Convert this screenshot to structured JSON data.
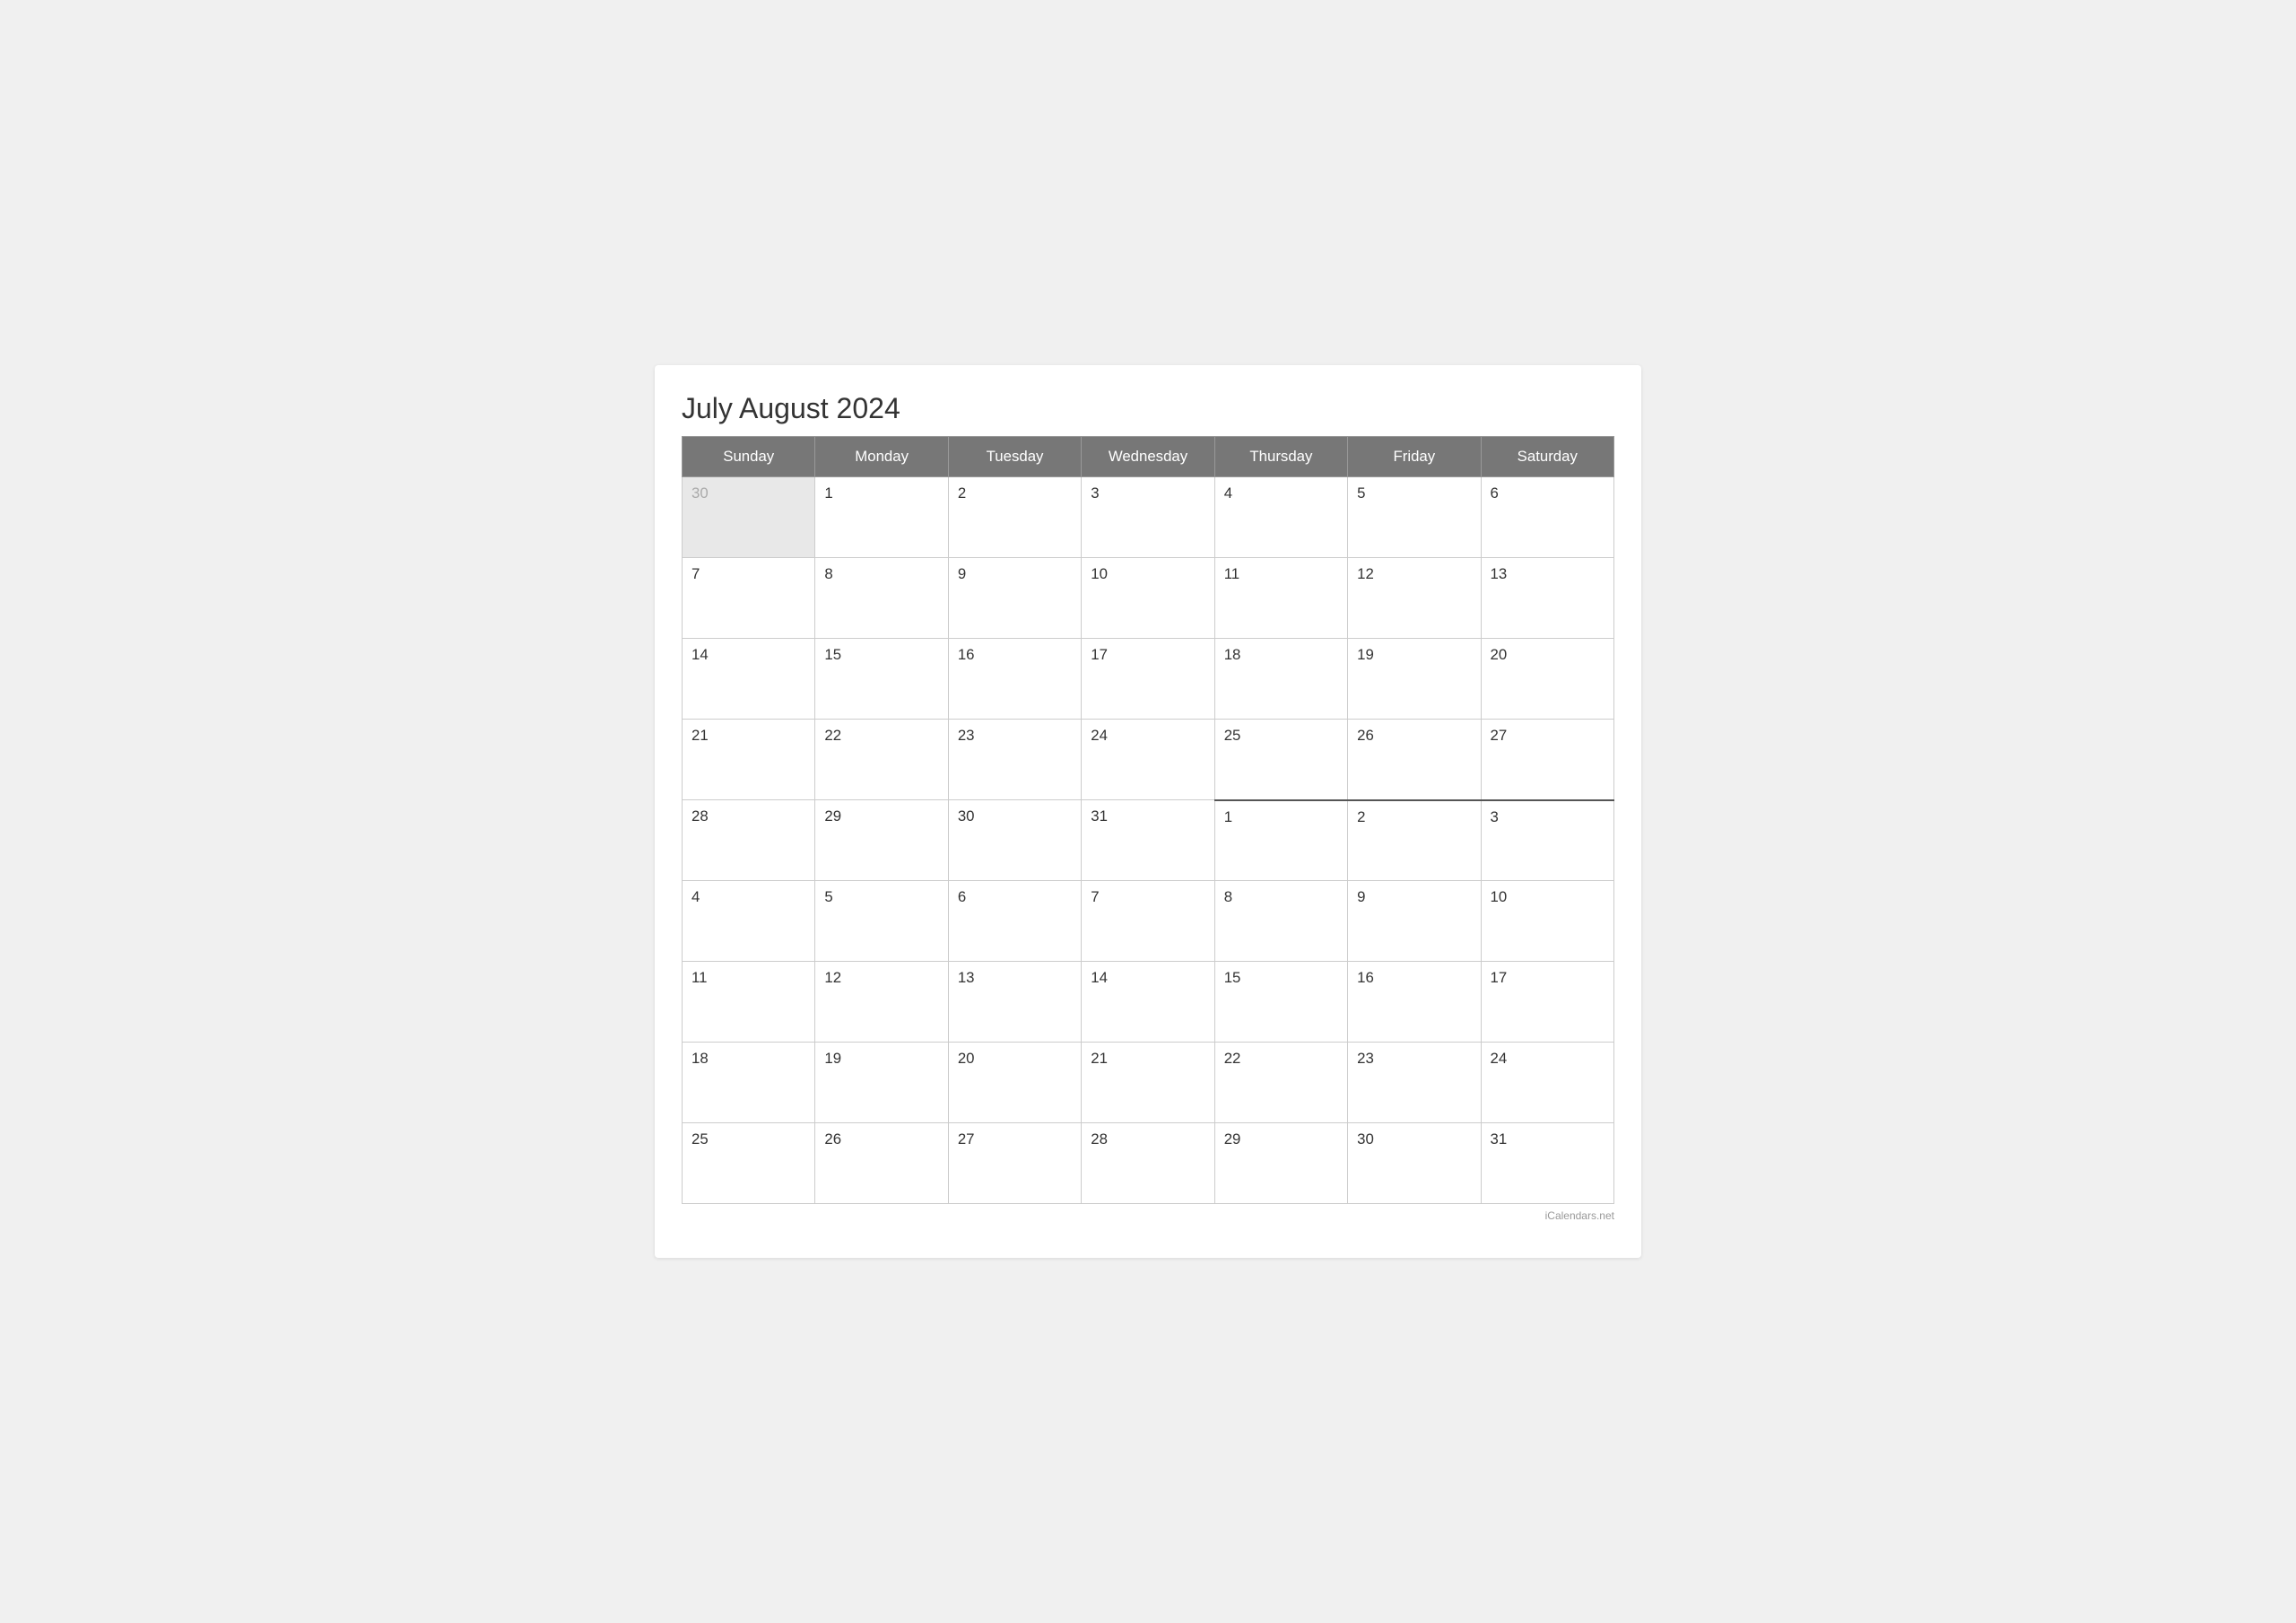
{
  "calendar": {
    "title": "July August 2024",
    "watermark": "iCalendars.net",
    "headers": [
      "Sunday",
      "Monday",
      "Tuesday",
      "Wednesday",
      "Thursday",
      "Friday",
      "Saturday"
    ],
    "weeks": [
      [
        {
          "day": "30",
          "outside": true
        },
        {
          "day": "1",
          "outside": false
        },
        {
          "day": "2",
          "outside": false
        },
        {
          "day": "3",
          "outside": false
        },
        {
          "day": "4",
          "outside": false
        },
        {
          "day": "5",
          "outside": false
        },
        {
          "day": "6",
          "outside": false
        }
      ],
      [
        {
          "day": "7",
          "outside": false
        },
        {
          "day": "8",
          "outside": false
        },
        {
          "day": "9",
          "outside": false
        },
        {
          "day": "10",
          "outside": false
        },
        {
          "day": "11",
          "outside": false
        },
        {
          "day": "12",
          "outside": false
        },
        {
          "day": "13",
          "outside": false
        }
      ],
      [
        {
          "day": "14",
          "outside": false
        },
        {
          "day": "15",
          "outside": false
        },
        {
          "day": "16",
          "outside": false
        },
        {
          "day": "17",
          "outside": false
        },
        {
          "day": "18",
          "outside": false
        },
        {
          "day": "19",
          "outside": false
        },
        {
          "day": "20",
          "outside": false
        }
      ],
      [
        {
          "day": "21",
          "outside": false
        },
        {
          "day": "22",
          "outside": false
        },
        {
          "day": "23",
          "outside": false
        },
        {
          "day": "24",
          "outside": false
        },
        {
          "day": "25",
          "outside": false
        },
        {
          "day": "26",
          "outside": false
        },
        {
          "day": "27",
          "outside": false
        }
      ],
      [
        {
          "day": "28",
          "outside": false
        },
        {
          "day": "29",
          "outside": false
        },
        {
          "day": "30",
          "outside": false
        },
        {
          "day": "31",
          "outside": false
        },
        {
          "day": "1",
          "outside": false,
          "boundary": true
        },
        {
          "day": "2",
          "outside": false,
          "boundary": true
        },
        {
          "day": "3",
          "outside": false,
          "boundary": true
        }
      ],
      [
        {
          "day": "4",
          "outside": false
        },
        {
          "day": "5",
          "outside": false
        },
        {
          "day": "6",
          "outside": false
        },
        {
          "day": "7",
          "outside": false
        },
        {
          "day": "8",
          "outside": false
        },
        {
          "day": "9",
          "outside": false
        },
        {
          "day": "10",
          "outside": false
        }
      ],
      [
        {
          "day": "11",
          "outside": false
        },
        {
          "day": "12",
          "outside": false
        },
        {
          "day": "13",
          "outside": false
        },
        {
          "day": "14",
          "outside": false
        },
        {
          "day": "15",
          "outside": false
        },
        {
          "day": "16",
          "outside": false
        },
        {
          "day": "17",
          "outside": false
        }
      ],
      [
        {
          "day": "18",
          "outside": false
        },
        {
          "day": "19",
          "outside": false
        },
        {
          "day": "20",
          "outside": false
        },
        {
          "day": "21",
          "outside": false
        },
        {
          "day": "22",
          "outside": false
        },
        {
          "day": "23",
          "outside": false
        },
        {
          "day": "24",
          "outside": false
        }
      ],
      [
        {
          "day": "25",
          "outside": false
        },
        {
          "day": "26",
          "outside": false
        },
        {
          "day": "27",
          "outside": false
        },
        {
          "day": "28",
          "outside": false
        },
        {
          "day": "29",
          "outside": false
        },
        {
          "day": "30",
          "outside": false
        },
        {
          "day": "31",
          "outside": false
        }
      ]
    ]
  }
}
